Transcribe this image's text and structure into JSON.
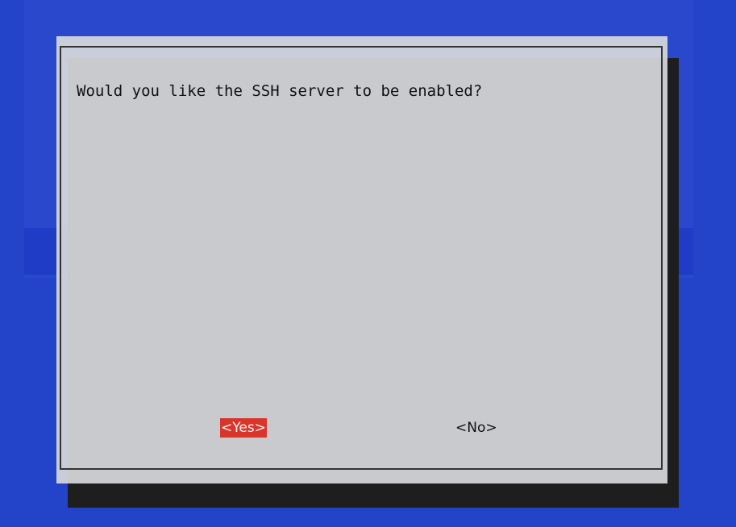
{
  "dialog": {
    "message": "Would you like the SSH server to be enabled?",
    "buttons": {
      "yes_label": "<Yes>",
      "no_label": "<No>"
    },
    "selected_button": "yes"
  },
  "colors": {
    "desktop_background": "#2343c8",
    "dialog_background": "#d6d7da",
    "selected_button": "#d9352a",
    "shadow": "#1e1e1e"
  }
}
